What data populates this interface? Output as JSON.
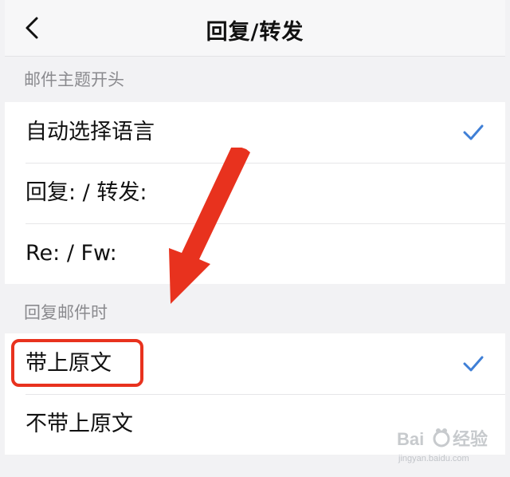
{
  "nav": {
    "title": "回复/转发",
    "back_icon": "chevron-left-icon"
  },
  "sections": [
    {
      "header": "邮件主题开头",
      "items": [
        {
          "label": "自动选择语言",
          "checked": true
        },
        {
          "label": "回复: / 转发:",
          "checked": false
        },
        {
          "label": "Re: /  Fw:",
          "checked": false
        }
      ]
    },
    {
      "header": "回复邮件时",
      "items": [
        {
          "label": "带上原文",
          "checked": true
        },
        {
          "label": "不带上原文",
          "checked": false
        }
      ]
    }
  ],
  "annotation": {
    "arrow_color": "#e8321e",
    "highlight_color": "#e8321e"
  },
  "watermark": {
    "brand": "Bai",
    "suffix": "经验",
    "url": "jingyan.baidu.com"
  },
  "colors": {
    "check": "#3f7fd6",
    "background": "#f2f2f4"
  }
}
